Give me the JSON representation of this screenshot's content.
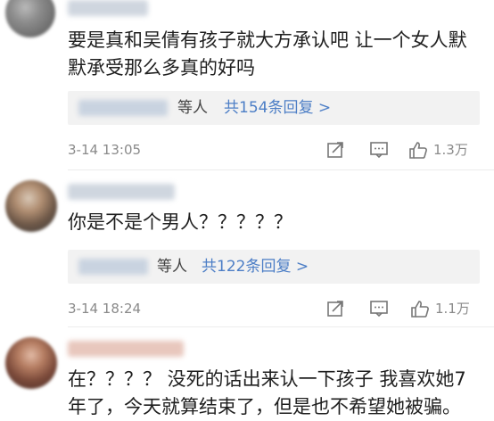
{
  "comments": [
    {
      "text": "要是真和吴倩有孩子就大方承认吧 让一个女人默\n默承受那么多真的好吗",
      "reply_suffix": "等人",
      "reply_link": "共154条回复 >",
      "timestamp": "3-14 13:05",
      "likes": "1.3万"
    },
    {
      "text": "你是不是个男人？？？？？",
      "reply_suffix": "等人",
      "reply_link": "共122条回复 >",
      "timestamp": "3-14 18:24",
      "likes": "1.1万"
    },
    {
      "text": "在？？？？ 没死的话出来认一下孩子 我喜欢她7\n年了，今天就算结束了，但是也不希望她被骗。"
    }
  ],
  "icons": {
    "share": "share-icon",
    "comment": "comment-icon",
    "like": "like-icon"
  },
  "colors": {
    "link": "#4c7ec6",
    "meta": "#8a8a8a"
  }
}
